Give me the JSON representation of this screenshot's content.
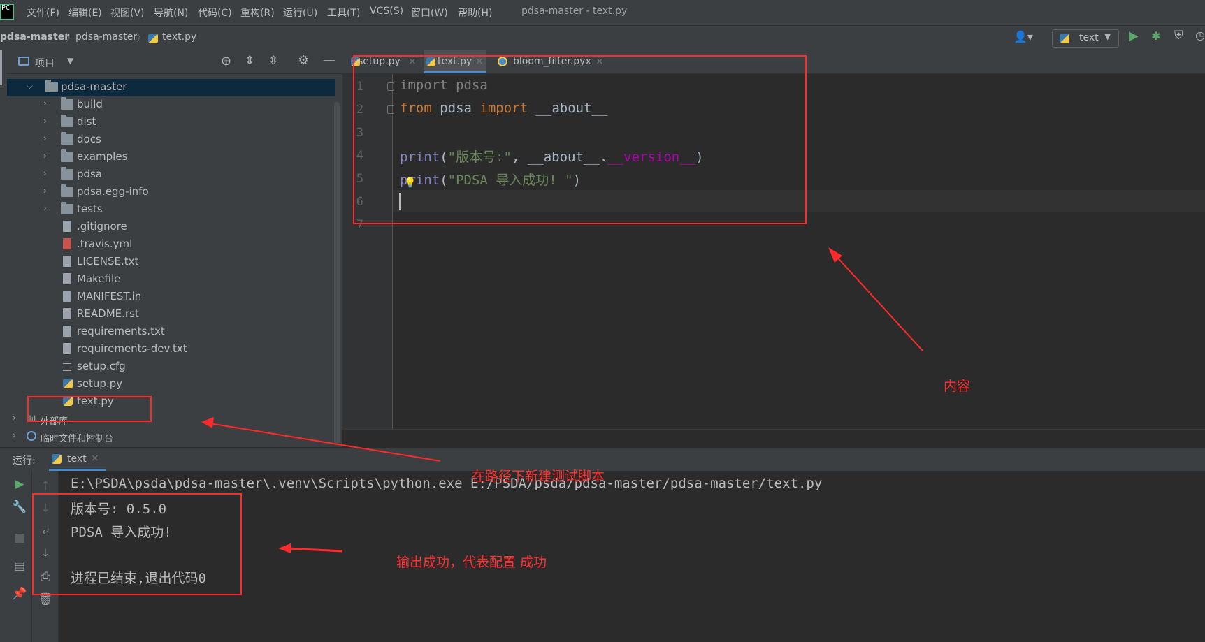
{
  "menubar": {
    "items": [
      "文件(F)",
      "编辑(E)",
      "视图(V)",
      "导航(N)",
      "代码(C)",
      "重构(R)",
      "运行(U)",
      "工具(T)",
      "VCS(S)",
      "窗口(W)",
      "帮助(H)"
    ],
    "window_title": "pdsa-master - text.py",
    "logo_text": "PC"
  },
  "navbar": {
    "crumbs": [
      "pdsa-master",
      "pdsa-master",
      "text.py"
    ],
    "run_config": "text"
  },
  "project": {
    "title": "项目",
    "tree": [
      {
        "label": "pdsa-master",
        "kind": "folder",
        "level": 0,
        "expanded": true,
        "selected": true
      },
      {
        "label": "build",
        "kind": "folder",
        "level": 1
      },
      {
        "label": "dist",
        "kind": "folder",
        "level": 1
      },
      {
        "label": "docs",
        "kind": "folder",
        "level": 1
      },
      {
        "label": "examples",
        "kind": "folder",
        "level": 1
      },
      {
        "label": "pdsa",
        "kind": "folder",
        "level": 1
      },
      {
        "label": "pdsa.egg-info",
        "kind": "folder",
        "level": 1
      },
      {
        "label": "tests",
        "kind": "folder",
        "level": 1
      },
      {
        "label": ".gitignore",
        "kind": "file",
        "level": 1
      },
      {
        "label": ".travis.yml",
        "kind": "file",
        "level": 1
      },
      {
        "label": "LICENSE.txt",
        "kind": "file",
        "level": 1
      },
      {
        "label": "Makefile",
        "kind": "file",
        "level": 1
      },
      {
        "label": "MANIFEST.in",
        "kind": "file",
        "level": 1
      },
      {
        "label": "README.rst",
        "kind": "file",
        "level": 1
      },
      {
        "label": "requirements.txt",
        "kind": "file",
        "level": 1
      },
      {
        "label": "requirements-dev.txt",
        "kind": "file",
        "level": 1
      },
      {
        "label": "setup.cfg",
        "kind": "file",
        "level": 1
      },
      {
        "label": "setup.py",
        "kind": "py",
        "level": 1
      },
      {
        "label": "text.py",
        "kind": "py",
        "level": 1
      },
      {
        "label": "外部库",
        "kind": "lib",
        "level": 0
      },
      {
        "label": "临时文件和控制台",
        "kind": "scratch",
        "level": 0
      }
    ]
  },
  "editor": {
    "tabs": [
      {
        "label": "setup.py",
        "active": false
      },
      {
        "label": "text.py",
        "active": true
      },
      {
        "label": "bloom_filter.pyx",
        "active": false
      }
    ],
    "line_numbers": [
      "1",
      "2",
      "3",
      "4",
      "5",
      "6",
      "7"
    ],
    "code": {
      "l1_kw": "import",
      "l1_rest": " pdsa",
      "l2_kw1": "from",
      "l2_mid": " pdsa ",
      "l2_kw2": "import",
      "l2_rest": " __about__",
      "l4_fn": "print",
      "l4_open": "(",
      "l4_str": "\"版本号:\"",
      "l4_mid": ", __about__.",
      "l4_dunder": "__version__",
      "l4_close": ")",
      "l5_fn": "print",
      "l5_open": "(",
      "l5_str": "\"PDSA 导入成功! \"",
      "l5_close": ")"
    }
  },
  "run": {
    "label": "运行:",
    "tab": "text",
    "console": [
      "E:\\PSDA\\psda\\pdsa-master\\.venv\\Scripts\\python.exe E:/PSDA/psda/pdsa-master/pdsa-master/text.py",
      "版本号: 0.5.0",
      "PDSA 导入成功!",
      "",
      "进程已结束,退出代码0"
    ]
  },
  "annotations": {
    "content": "内容",
    "new_script": "在路径下新建测试脚本",
    "output_ok": "输出成功，代表配置 成功",
    "color": "#ff2a2a"
  }
}
